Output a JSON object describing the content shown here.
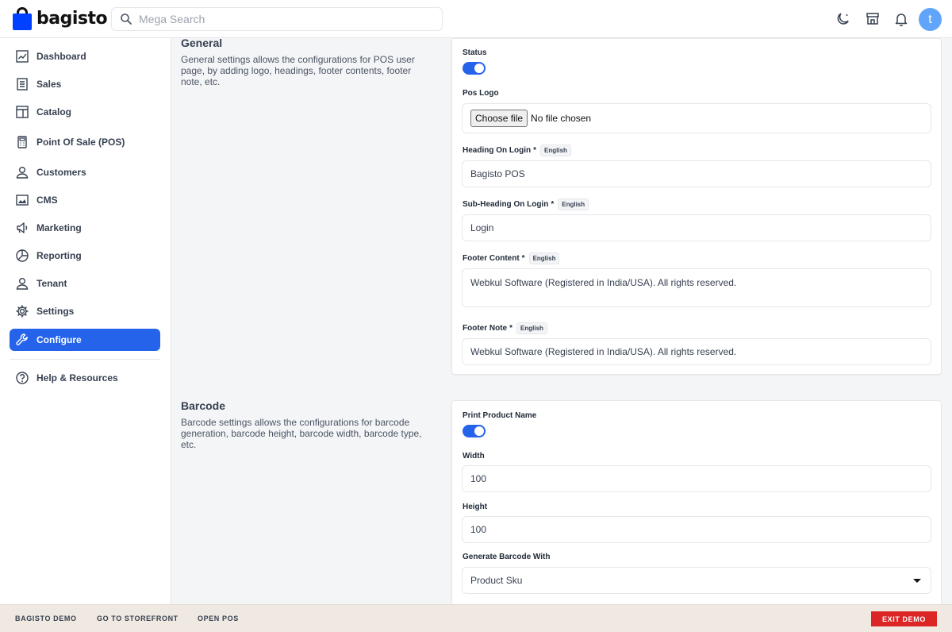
{
  "header": {
    "logo_text": "bagisto",
    "search_placeholder": "Mega Search",
    "avatar_letter": "t"
  },
  "sidebar": {
    "items": [
      {
        "label": "Dashboard",
        "icon": "dashboard-icon"
      },
      {
        "label": "Sales",
        "icon": "sales-icon"
      },
      {
        "label": "Catalog",
        "icon": "catalog-icon"
      },
      {
        "label": "Point Of Sale (POS)",
        "icon": "pos-icon"
      },
      {
        "label": "Customers",
        "icon": "customers-icon"
      },
      {
        "label": "CMS",
        "icon": "cms-icon"
      },
      {
        "label": "Marketing",
        "icon": "marketing-icon"
      },
      {
        "label": "Reporting",
        "icon": "reporting-icon"
      },
      {
        "label": "Tenant",
        "icon": "tenant-icon"
      },
      {
        "label": "Settings",
        "icon": "settings-icon"
      },
      {
        "label": "Configure",
        "icon": "configure-icon",
        "active": true
      }
    ],
    "help": {
      "label": "Help & Resources",
      "icon": "help-icon"
    }
  },
  "general": {
    "title": "General",
    "description": "General settings allows the configurations for POS user page, by adding logo, headings, footer contents, footer note, etc.",
    "status_label": "Status",
    "status_on": true,
    "logo_label": "Pos Logo",
    "file_button": "Choose file",
    "file_status": "No file chosen",
    "heading_label": "Heading On Login",
    "heading_value": "Bagisto POS",
    "subheading_label": "Sub-Heading On Login",
    "subheading_value": "Login",
    "footer_content_label": "Footer Content",
    "footer_content_value": "Webkul Software (Registered in India/USA). All rights reserved.",
    "footer_note_label": "Footer Note",
    "footer_note_value": "Webkul Software (Registered in India/USA). All rights reserved.",
    "required_mark": "*",
    "locale_badge": "English"
  },
  "barcode": {
    "title": "Barcode",
    "description": "Barcode settings allows the configurations for barcode generation, barcode height, barcode width, barcode type, etc.",
    "print_name_label": "Print Product Name",
    "print_name_on": true,
    "width_label": "Width",
    "width_value": "100",
    "height_label": "Height",
    "height_value": "100",
    "generate_label": "Generate Barcode With",
    "generate_value": "Product Sku"
  },
  "footer": {
    "demo": "BAGISTO DEMO",
    "storefront": "GO TO STOREFRONT",
    "open_pos": "OPEN POS",
    "exit": "EXIT DEMO"
  },
  "colors": {
    "accent": "#2563eb",
    "brand": "#0041ff",
    "exit": "#dc2626",
    "footer_bg": "#f0e9e1"
  }
}
